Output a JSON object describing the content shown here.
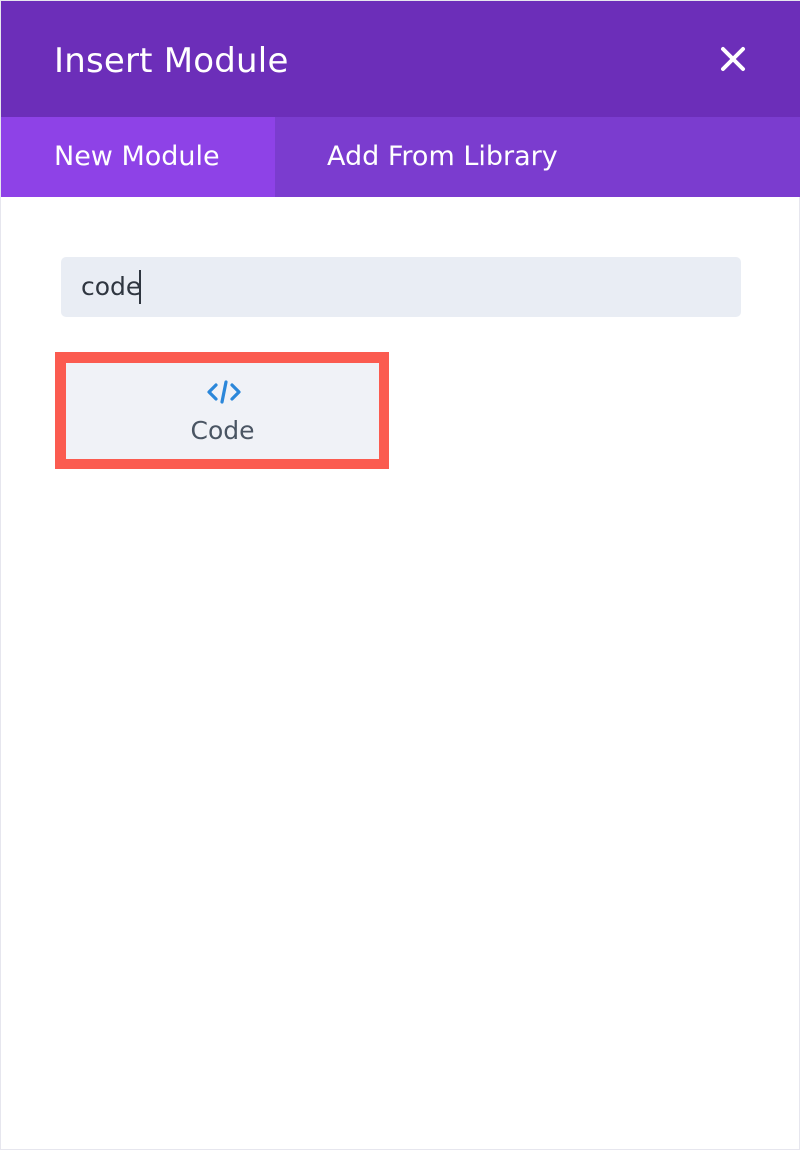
{
  "modal": {
    "title": "Insert Module",
    "header_color": "#6c2eb9",
    "close_icon": "close-icon"
  },
  "tabs": [
    {
      "label": "New Module",
      "active": true
    },
    {
      "label": "Add From Library",
      "active": false
    }
  ],
  "search": {
    "value": "code",
    "placeholder": ""
  },
  "modules": [
    {
      "label": "Code",
      "icon": "code-icon",
      "icon_color": "#2b87da",
      "highlighted": true,
      "highlight_color": "#fb5b50"
    }
  ]
}
